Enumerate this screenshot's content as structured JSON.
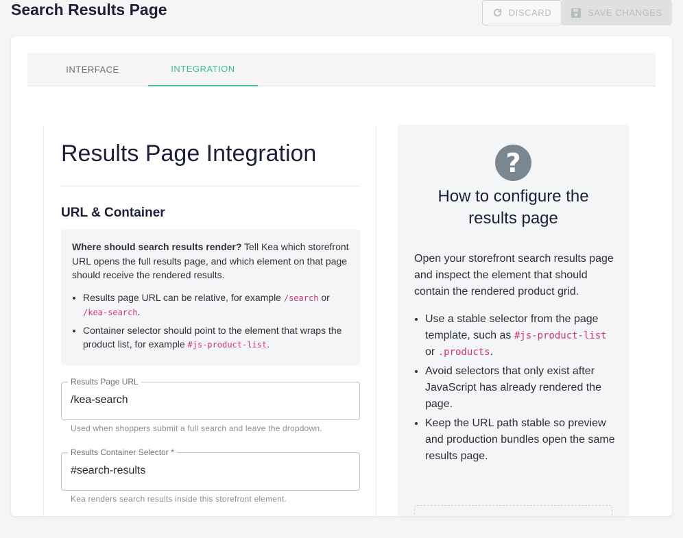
{
  "page": {
    "title": "Search Results Page"
  },
  "toolbar": {
    "discard_label": "DISCARD",
    "save_label": "SAVE CHANGES"
  },
  "tabs": [
    {
      "label": "INTERFACE",
      "active": false
    },
    {
      "label": "INTEGRATION",
      "active": true
    }
  ],
  "colors": {
    "accent": "#3fbf86",
    "code": "#d6337a",
    "title": "#1b1f3a"
  },
  "icons": {
    "discard": "refresh-icon",
    "save": "save-icon",
    "help": "help-icon"
  },
  "left": {
    "heading": "Results Page Integration",
    "section": "URL & Container",
    "info": {
      "lead_bold": "Where should search results render?",
      "lead_text": " Tell Kea which storefront URL opens the full results page, and which element on that page should receive the rendered results.",
      "bullet1_pre": "Results page URL can be relative, for example ",
      "bullet1_code1": "/search",
      "bullet1_mid": " or ",
      "bullet1_code2": "/kea-search",
      "bullet1_post": ".",
      "bullet2_pre": "Container selector should point to the element that wraps the product list, for example ",
      "bullet2_code": "#js-product-list",
      "bullet2_post": "."
    },
    "fields": [
      {
        "label": "Results Page URL",
        "value": "/kea-search",
        "hint": "Used when shoppers submit a full search and leave the dropdown."
      },
      {
        "label": "Results Container Selector *",
        "value": "#search-results",
        "hint": "Kea renders search results inside this storefront element."
      }
    ]
  },
  "right": {
    "help_glyph": "?",
    "title": "How to configure the results page",
    "intro": "Open your storefront search results page and inspect the element that should contain the rendered product grid.",
    "b1_pre": "Use a stable selector from the page template, such as ",
    "b1_code1": "#js-product-list",
    "b1_mid": " or ",
    "b1_code2": ".products",
    "b1_post": ".",
    "b2": "Avoid selectors that only exist after JavaScript has already rendered the page.",
    "b3": "Keep the URL path stable so preview and production bundles open the same results page."
  }
}
